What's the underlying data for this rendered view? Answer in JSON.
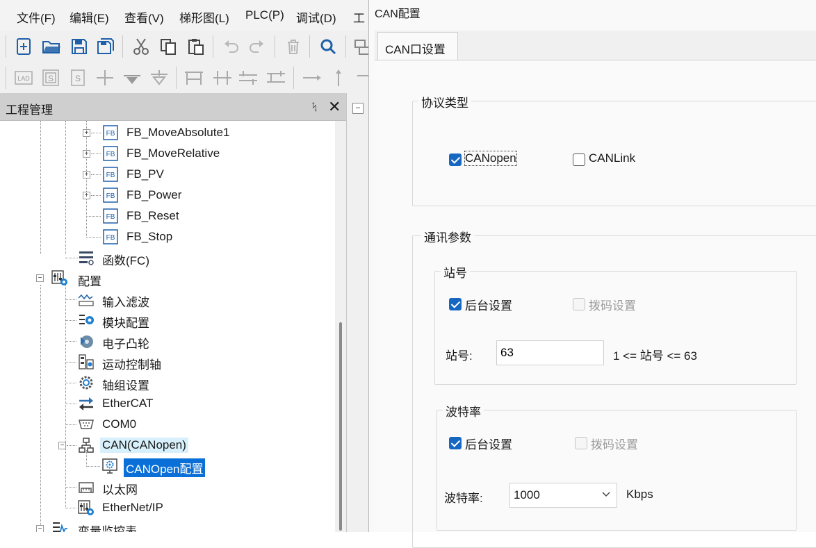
{
  "menubar": {
    "items": [
      "文件(F)",
      "编辑(E)",
      "查看(V)",
      "梯形图(L)",
      "PLC(P)",
      "调试(D)",
      "工"
    ]
  },
  "toolbar": {
    "row1": [
      "new-file-icon",
      "open-folder-icon",
      "save-icon",
      "save-all-icon",
      "cut-icon",
      "copy-icon",
      "paste-icon",
      "undo-icon",
      "redo-icon",
      "delete-icon",
      "search-icon",
      "network-icon"
    ],
    "row2": [
      "lad-icon",
      "s-block-icon",
      "s-outline-icon",
      "contact-icon",
      "coil-down-icon",
      "coil-down-outline-icon",
      "parallel-branch-icon",
      "parallel-join-icon",
      "parallel-close-icon",
      "parallel-open-icon",
      "horizontal-line-icon",
      "vertical-line-icon"
    ],
    "lad_text": "LAD",
    "s_text": "S"
  },
  "project_panel": {
    "title": "工程管理",
    "pin_glyph": "ᛪ",
    "close_glyph": "✕"
  },
  "tree": {
    "fb_nodes": [
      "FB_MoveAbsolute1",
      "FB_MoveRelative",
      "FB_PV",
      "FB_Power",
      "FB_Reset",
      "FB_Stop"
    ],
    "fb_icon_text": "FB",
    "fc_node": "函数(FC)",
    "config_node": "配置",
    "config_children": [
      "输入滤波",
      "模块配置",
      "电子凸轮",
      "运动控制轴",
      "轴组设置",
      "EtherCAT",
      "COM0"
    ],
    "can_node": "CAN(CANopen)",
    "can_child": "CANOpen配置",
    "after_can": [
      "以太网",
      "EtherNet/IP"
    ],
    "last_node": "变量监控表"
  },
  "dialog": {
    "title": "CAN配置",
    "tab_label": "CAN口设置",
    "protocol_group": {
      "legend": "协议类型",
      "canopen_label": "CANopen",
      "canopen_checked": true,
      "canlink_label": "CANLink",
      "canlink_checked": false
    },
    "comm_group": {
      "legend": "通讯参数",
      "station_group": {
        "legend": "站号",
        "backend_label": "后台设置",
        "backend_checked": true,
        "dip_label": "拨码设置",
        "dip_checked": false,
        "field_label": "站号:",
        "value": "63",
        "range_text": "1 <= 站号 <= 63"
      },
      "baud_group": {
        "legend": "波特率",
        "backend_label": "后台设置",
        "backend_checked": true,
        "dip_label": "拨码设置",
        "dip_checked": false,
        "field_label": "波特率:",
        "value": "1000",
        "unit": "Kbps"
      }
    }
  },
  "colors": {
    "selection": "#0a6fd6",
    "hover_highlight": "#d8f0fb",
    "checkbox_checked": "#1667c2",
    "icon_blue": "#1f5fa8"
  }
}
